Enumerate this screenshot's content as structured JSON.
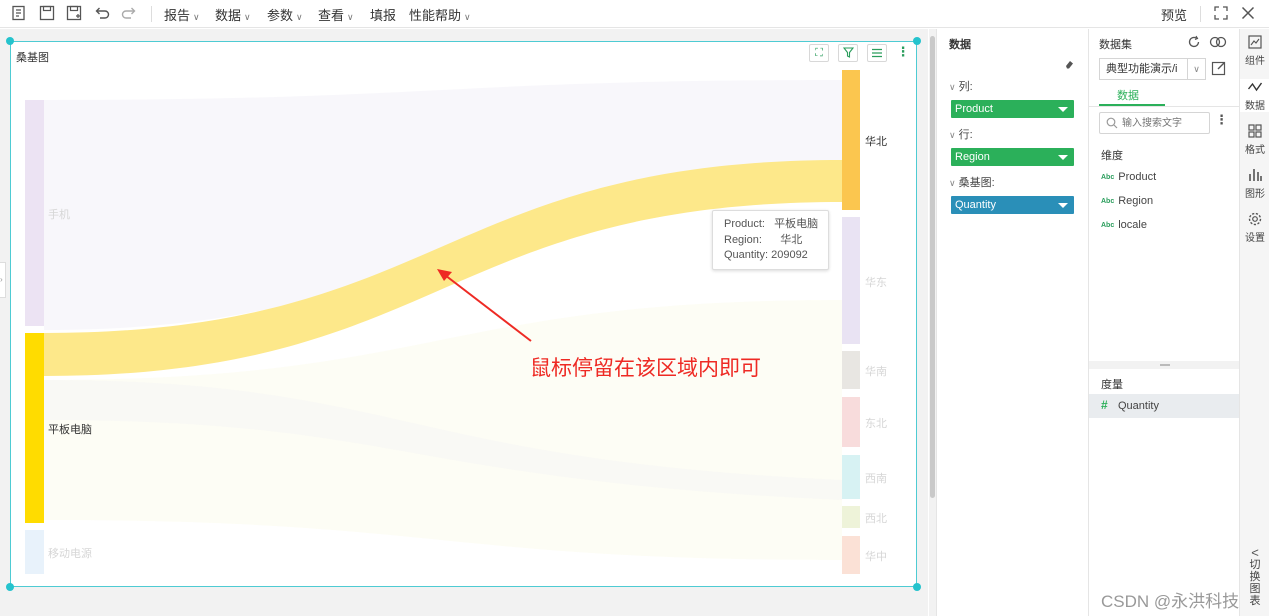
{
  "toolbar": {
    "menus": [
      {
        "label": "报告"
      },
      {
        "label": "数据"
      },
      {
        "label": "参数"
      },
      {
        "label": "查看"
      },
      {
        "label": "填报"
      },
      {
        "label": "性能帮助"
      }
    ],
    "preview_label": "预览"
  },
  "widget": {
    "title": "桑基图"
  },
  "sankey": {
    "sources": [
      {
        "name": "手机",
        "color": "#ece3f3"
      },
      {
        "name": "平板电脑",
        "color": "#ffdc00"
      },
      {
        "name": "移动电源",
        "color": "#e8f2fb"
      }
    ],
    "targets": [
      {
        "name": "华北",
        "color": "#fbc64f"
      },
      {
        "name": "华东",
        "color": "#e9e3f3"
      },
      {
        "name": "华南",
        "color": "#e8e6e2"
      },
      {
        "name": "东北",
        "color": "#f8dcdc"
      },
      {
        "name": "西南",
        "color": "#d7f2f3"
      },
      {
        "name": "西北",
        "color": "#eef3d9"
      },
      {
        "name": "华中",
        "color": "#fbe1d6"
      }
    ],
    "highlight_link_color": "#fde88a"
  },
  "tooltip": {
    "product_label": "Product:",
    "product_value": "平板电脑",
    "region_label": "Region:",
    "region_value": "华北",
    "quantity_label": "Quantity:",
    "quantity_value": "209092"
  },
  "annotation": {
    "text": "鼠标停留在该区域内即可",
    "color": "#ee2a24"
  },
  "data_panel": {
    "title": "数据",
    "columns_label": "列:",
    "columns_field": "Product",
    "rows_label": "行:",
    "rows_field": "Region",
    "sankey_label": "桑基图:",
    "sankey_field": "Quantity",
    "dim_pill_color": "#2bb05a",
    "measure_pill_color": "#2a8fb8"
  },
  "dataset_panel": {
    "title": "数据集",
    "dataset_name": "典型功能演示/i",
    "tab_label": "数据",
    "search_placeholder": "输入搜索文字",
    "dimension_header": "维度",
    "dimensions": [
      "Product",
      "Region",
      "locale"
    ],
    "measure_header": "度量",
    "measures": [
      "Quantity"
    ]
  },
  "right_bar": {
    "items": [
      "组件",
      "数据",
      "格式",
      "图形",
      "设置"
    ],
    "switch_label": "切换图表"
  },
  "watermark": "CSDN @永洪科技"
}
